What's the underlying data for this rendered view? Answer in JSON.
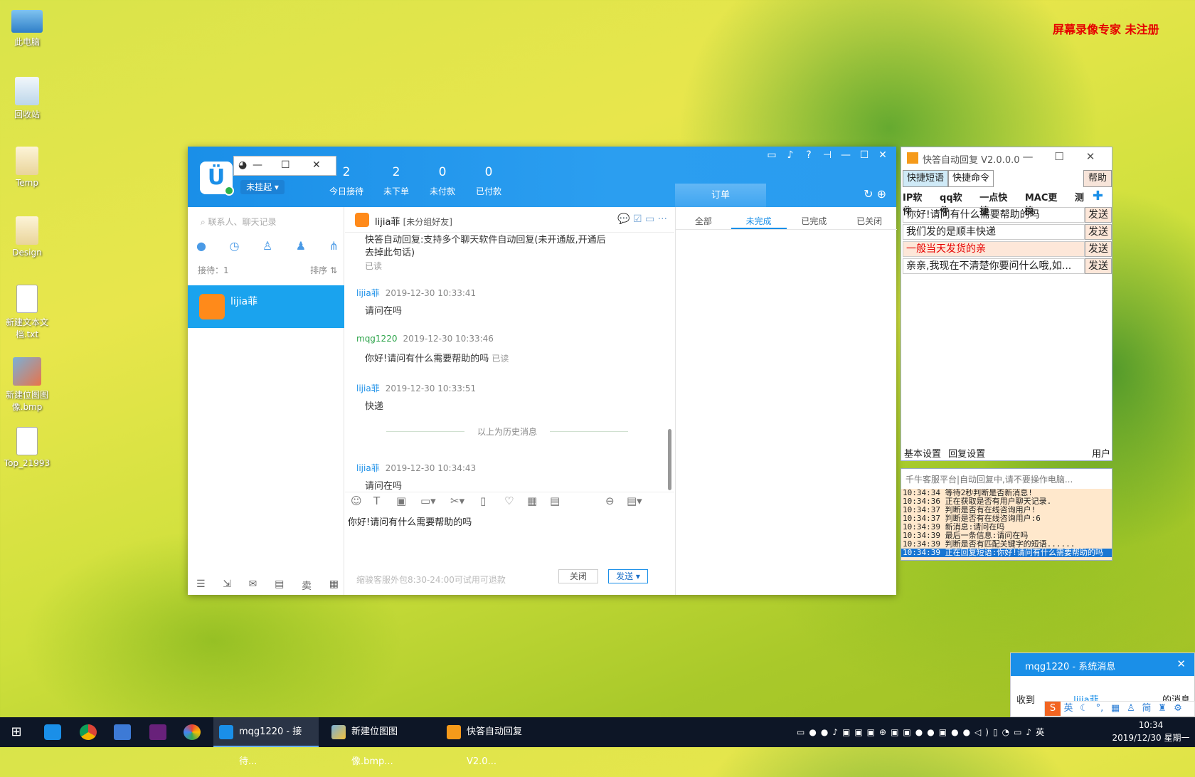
{
  "desktop": {
    "icons": [
      {
        "label": "此电脑"
      },
      {
        "label": "回收站"
      },
      {
        "label": "Temp"
      },
      {
        "label": "Design"
      },
      {
        "label": "新建文本文档.txt"
      },
      {
        "label": "新建位图图像.bmp"
      },
      {
        "label": "Top_21993"
      }
    ],
    "recorder_watermark": "屏幕录像专家  未注册"
  },
  "qianniu": {
    "status": "未挂起 ▾",
    "stats": [
      {
        "num": "2",
        "label": "今日接待"
      },
      {
        "num": "2",
        "label": "未下单"
      },
      {
        "num": "0",
        "label": "未付款"
      },
      {
        "num": "0",
        "label": "已付款"
      }
    ],
    "order_tab": "订单",
    "search_placeholder": "联系人、聊天记录",
    "reception_count": "接待：1",
    "sort_label": "排序 ⇅",
    "contact_name": "lijia菲",
    "chat_header_name": "lijia菲",
    "chat_header_group": "[未分组好友]",
    "messages": {
      "m0_text": "快答自动回复:支持多个聊天软件自动回复(未开通版,开通后去掉此句话)",
      "m0_read": "已读",
      "m1_sender": "lijia菲",
      "m1_time": "2019-12-30 10:33:41",
      "m1_text": "请问在吗",
      "m2_sender": "mqg1220",
      "m2_time": "2019-12-30 10:33:46",
      "m2_text": "你好!请问有什么需要帮助的吗",
      "m2_read": "已读",
      "m3_sender": "lijia菲",
      "m3_time": "2019-12-30 10:33:51",
      "m3_text": "快递",
      "history_divider": "以上为历史消息",
      "m4_sender": "lijia菲",
      "m4_time": "2019-12-30 10:34:43",
      "m4_text": "请问在吗"
    },
    "input_text": "你好!请问有什么需要帮助的吗",
    "hint": "缩骏客服外包8:30-24:00可试用可退款",
    "close_label": "关闭",
    "send_label": "发送 ▾",
    "order_tabs": [
      "全部",
      "未完成",
      "已完成",
      "已关闭"
    ]
  },
  "autoreply": {
    "title": "快答自动回复 V2.0.0.0",
    "btn_phrases": "快捷短语",
    "btn_commands": "快捷命令",
    "btn_help": "帮助",
    "tabs": [
      "IP软件",
      "qq软件",
      "一点快捷",
      "MAC更换",
      "测"
    ],
    "rows": [
      {
        "text": "你好!请问有什么需要帮助的吗",
        "send": "发送"
      },
      {
        "text": "我们发的是顺丰快递",
        "send": "发送"
      },
      {
        "text": "一般当天发货的亲",
        "send": "发送"
      },
      {
        "text": "亲亲,我现在不清楚你要问什么哦,如...",
        "send": "发送"
      }
    ],
    "bottom_basic": "基本设置",
    "bottom_reply": "回复设置",
    "bottom_user": "用户",
    "accent_red": "#e60000"
  },
  "log": {
    "header": "千牛客服平台|自动回复中,请不要操作电脑...",
    "lines": [
      "10:34:34 等待2秒判断是否新消息!",
      "10:34:36 正在获取是否有用户聊天记录.",
      "10:34:37 判断是否有在线咨询用户!",
      "10:34:37 判断是否有在线咨询用户:6",
      "10:34:39 新消息:请问在吗",
      "10:34:39 最后一条信息:请问在吗",
      "10:34:39 判断是否有匹配关键字的短语......",
      "10:34:39 正在回复短语:你好!请问有什么需要帮助的吗"
    ]
  },
  "notification": {
    "title": "mqg1220 - 系统消息",
    "received": "收到",
    "from": "lijia菲",
    "suffix": "的消息"
  },
  "ime": {
    "items": [
      "英",
      "简"
    ]
  },
  "taskbar": {
    "tasks": [
      {
        "label": "mqg1220 - 接待..."
      },
      {
        "label": "新建位图图像.bmp..."
      },
      {
        "label": "快答自动回复 V2.0..."
      }
    ],
    "tray_lang": "英",
    "time": "10:34",
    "date": "2019/12/30 星期一"
  }
}
